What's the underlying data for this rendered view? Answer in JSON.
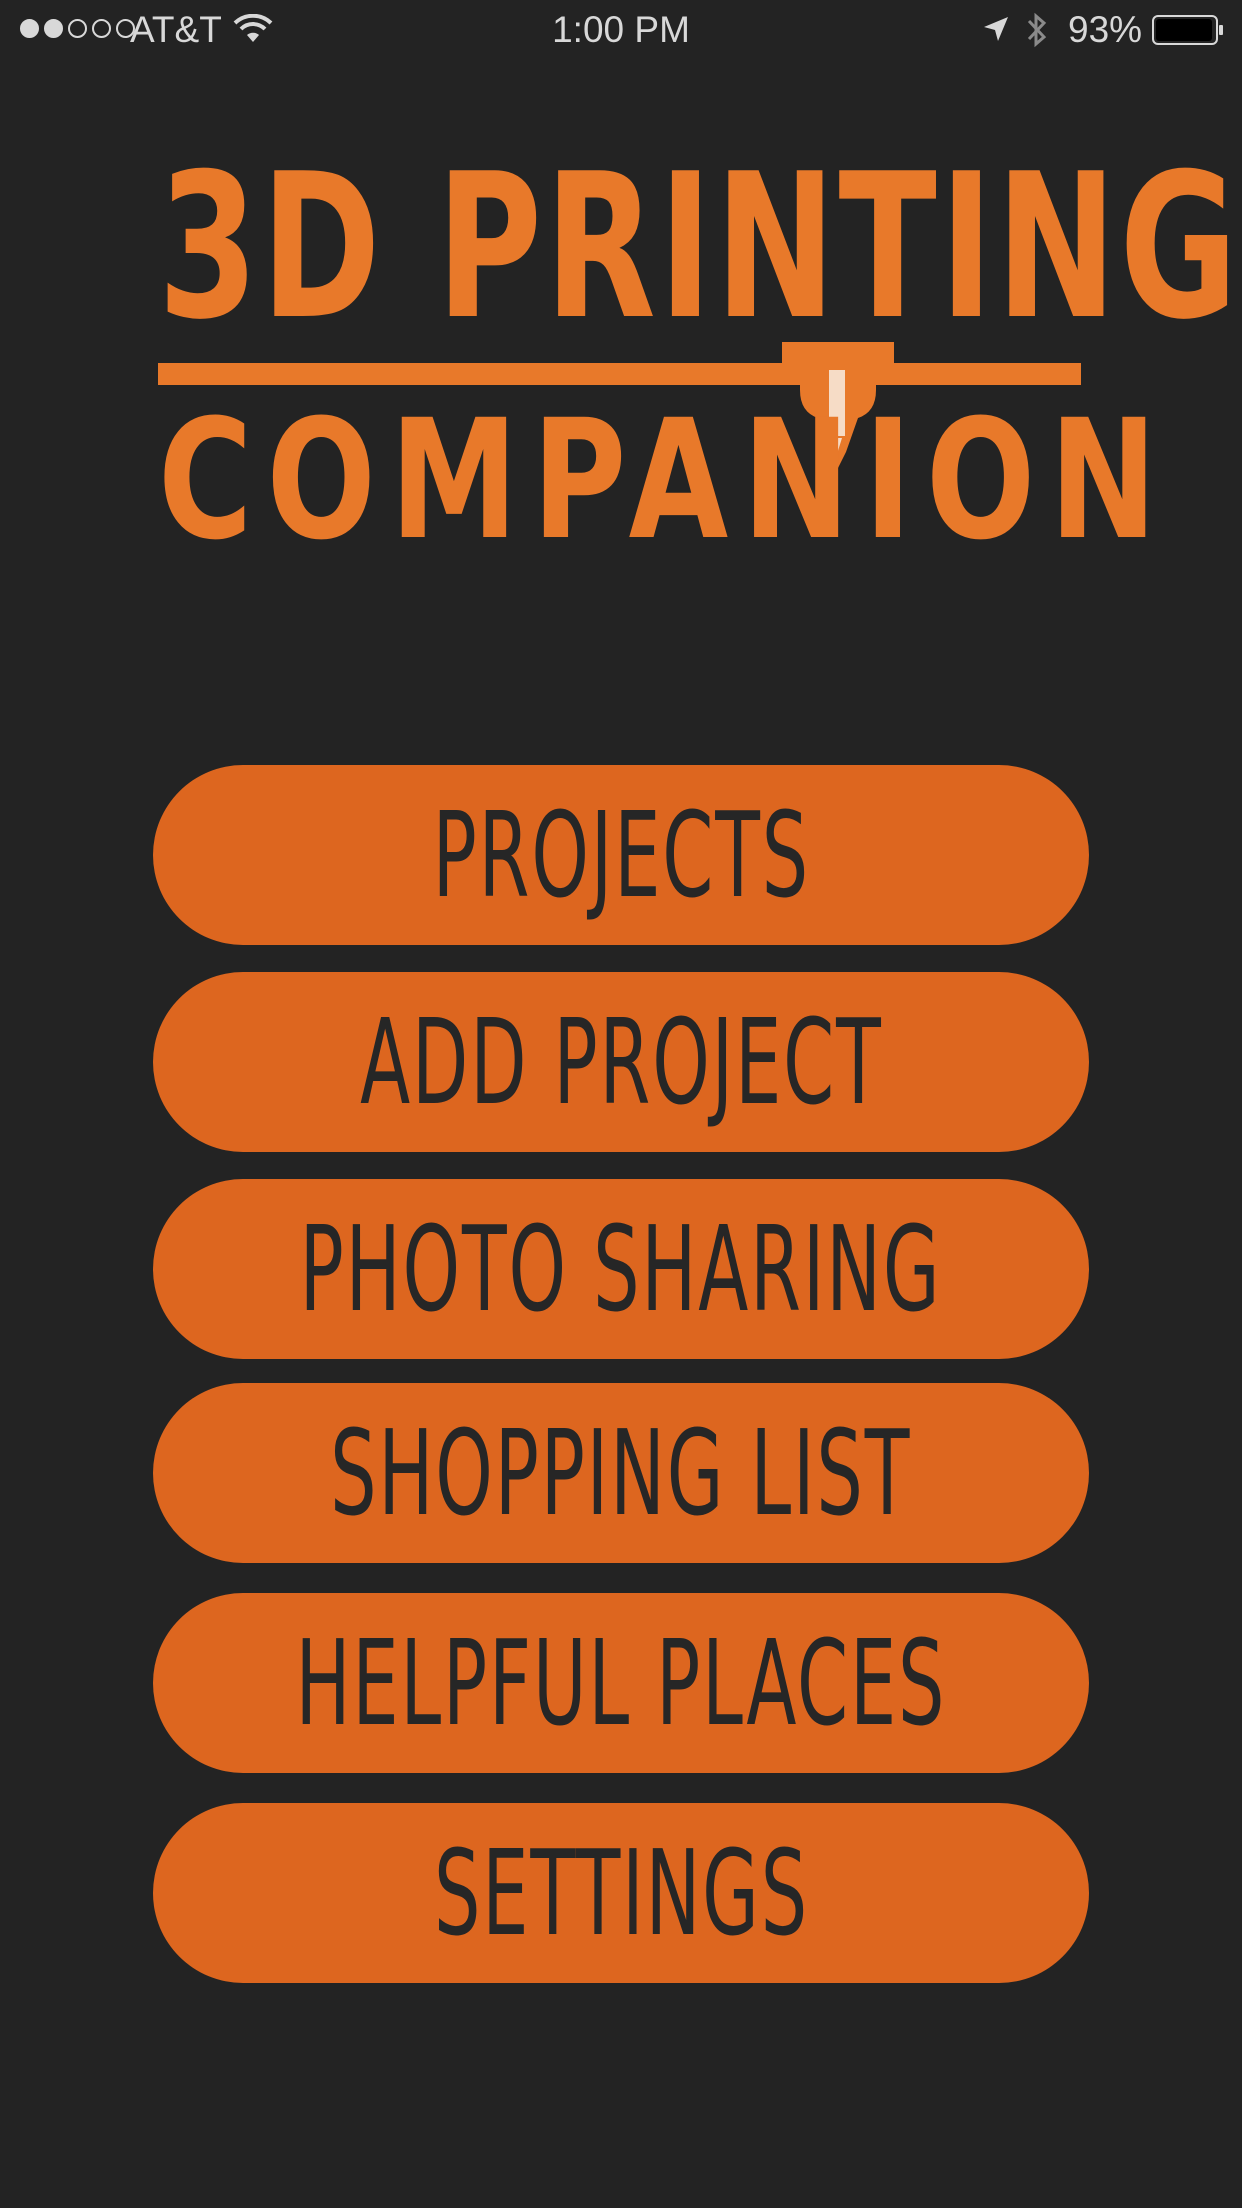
{
  "status_bar": {
    "carrier": "AT&T",
    "time": "1:00 PM",
    "battery_percent": "93%",
    "signal_bars_filled": 2,
    "signal_bars_total": 5,
    "icons": [
      "signal-dots-icon",
      "wifi-icon",
      "location-arrow-icon",
      "bluetooth-icon",
      "battery-icon"
    ]
  },
  "logo": {
    "line1": "3D PRINTING",
    "line2": "COMPANION",
    "color": "#e8792a"
  },
  "menu": {
    "button_color": "#dd661f",
    "label_color": "#262626",
    "items": [
      {
        "label": "PROJECTS"
      },
      {
        "label": "ADD PROJECT"
      },
      {
        "label": "PHOTO SHARING"
      },
      {
        "label": "SHOPPING LIST"
      },
      {
        "label": "HELPFUL PLACES"
      },
      {
        "label": "SETTINGS"
      }
    ]
  },
  "background_color": "#232323"
}
